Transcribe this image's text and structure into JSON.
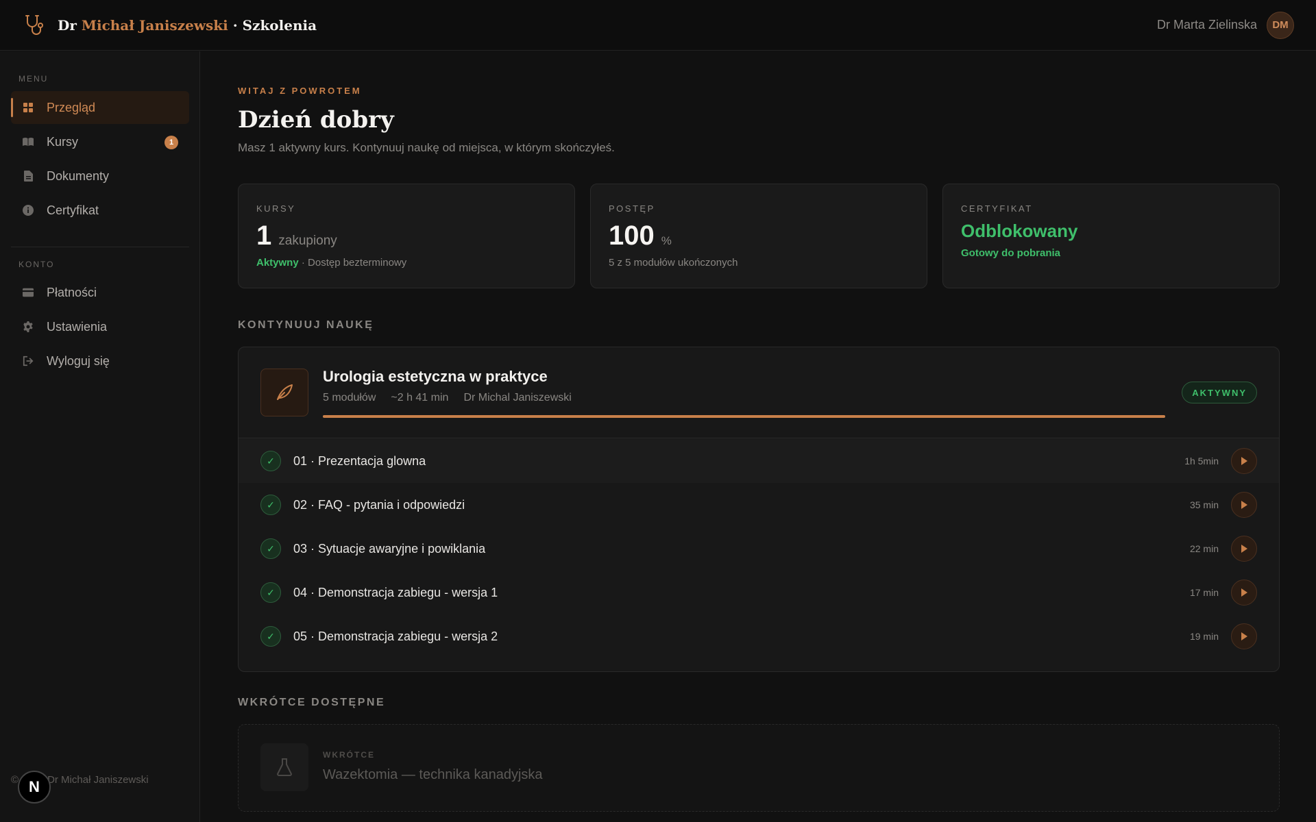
{
  "header": {
    "brand_prefix": "Dr ",
    "brand_name": "Michał Janiszewski",
    "brand_suffix": " · Szkolenia",
    "user_name": "Dr Marta Zielinska",
    "avatar_initials": "DM",
    "logo_icon": "stethoscope-icon"
  },
  "sidebar": {
    "menu_label": "MENU",
    "account_label": "KONTO",
    "menu_items": [
      {
        "label": "Przegląd",
        "icon": "grid-icon",
        "active": true
      },
      {
        "label": "Kursy",
        "icon": "book-icon",
        "badge": "1"
      },
      {
        "label": "Dokumenty",
        "icon": "document-icon"
      },
      {
        "label": "Certyfikat",
        "icon": "info-icon"
      }
    ],
    "account_items": [
      {
        "label": "Płatności",
        "icon": "credit-card-icon"
      },
      {
        "label": "Ustawienia",
        "icon": "gear-icon"
      },
      {
        "label": "Wyloguj się",
        "icon": "logout-icon"
      }
    ],
    "footer": "Dr Michał Janiszewski",
    "footer_symbol": "©",
    "next_badge": "N"
  },
  "main": {
    "eyebrow": "WITAJ Z POWROTEM",
    "title": "Dzień dobry",
    "subtitle": "Masz 1 aktywny kurs. Kontynuuj naukę od miejsca, w którym skończyłeś.",
    "stats": {
      "courses": {
        "label": "KURSY",
        "value": "1",
        "unit": "zakupiony",
        "status": "Aktywny",
        "detail": " · Dostęp bezterminowy"
      },
      "progress": {
        "label": "POSTĘP",
        "value": "100",
        "unit": "%",
        "detail": "5 z 5 modułów ukończonych"
      },
      "certificate": {
        "label": "CERTYFIKAT",
        "value": "Odblokowany",
        "detail": "Gotowy do pobrania"
      }
    },
    "continue_title": "KONTYNUUJ NAUKĘ",
    "course": {
      "title": "Urologia estetyczna w praktyce",
      "modules": "5 modułów",
      "duration": "~2 h 41 min",
      "author": "Dr Michal Janiszewski",
      "status": "AKTYWNY",
      "progress": 1.0,
      "icon": "leaf-icon",
      "lessons": [
        {
          "title": "01 · Prezentacja glowna",
          "duration": "1h 5min"
        },
        {
          "title": "02 · FAQ - pytania i odpowiedzi",
          "duration": "35 min"
        },
        {
          "title": "03 · Sytuacje awaryjne i powiklania",
          "duration": "22 min"
        },
        {
          "title": "04 · Demonstracja zabiegu - wersja 1",
          "duration": "17 min"
        },
        {
          "title": "05 · Demonstracja zabiegu - wersja 2",
          "duration": "19 min"
        }
      ]
    },
    "soon_title": "WKRÓTCE DOSTĘPNE",
    "soon": {
      "tag": "WKRÓTCE",
      "title": "Wazektomia — technika kanadyjska",
      "icon": "flask-icon"
    }
  },
  "colors": {
    "accent": "#c8804a",
    "success": "#3fbf6b",
    "background": "#111111"
  }
}
